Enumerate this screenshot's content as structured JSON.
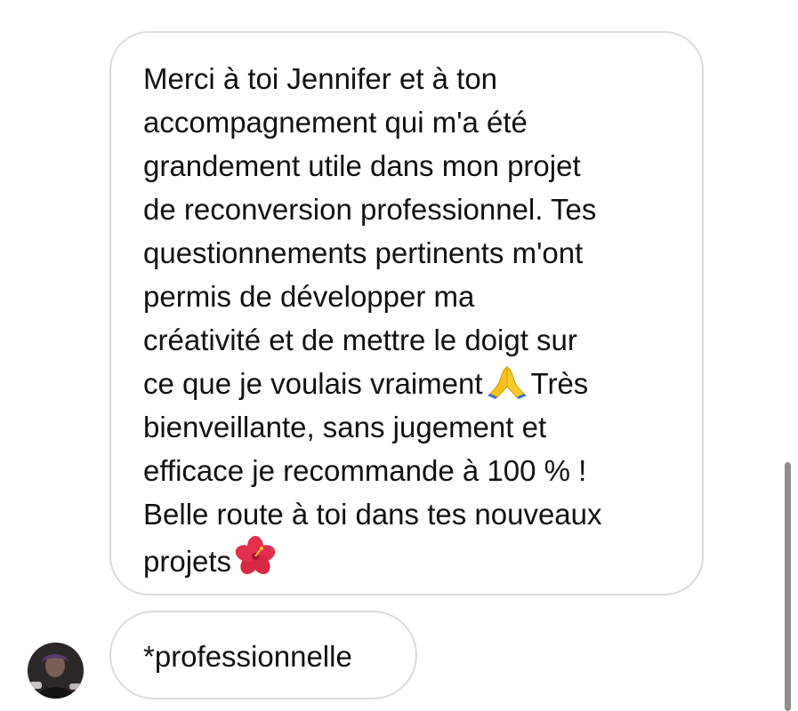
{
  "messages": [
    {
      "text_part1": "Merci à toi Jennifer et à ton\naccompagnement qui m'a été\ngrandement utile dans mon projet\nde reconversion professionnel. Tes\nquestionnements pertinents m'ont\npermis de développer ma\ncréativité et de mettre le doigt sur\nce que je voulais vraiment",
      "emoji1": "folded-hands-icon",
      "text_part2": "Très\nbienveillante, sans jugement et\nefficace je recommande à 100 % !\nBelle route à toi dans tes nouveaux\nprojets",
      "emoji2": "hibiscus-icon"
    },
    {
      "text": "*professionnelle"
    }
  ],
  "sender": {
    "avatar_icon": "user-avatar"
  },
  "colors": {
    "bubble_border": "#dbdbdb",
    "text": "#111111",
    "background": "#ffffff",
    "scrollbar": "#8e8e8e"
  }
}
